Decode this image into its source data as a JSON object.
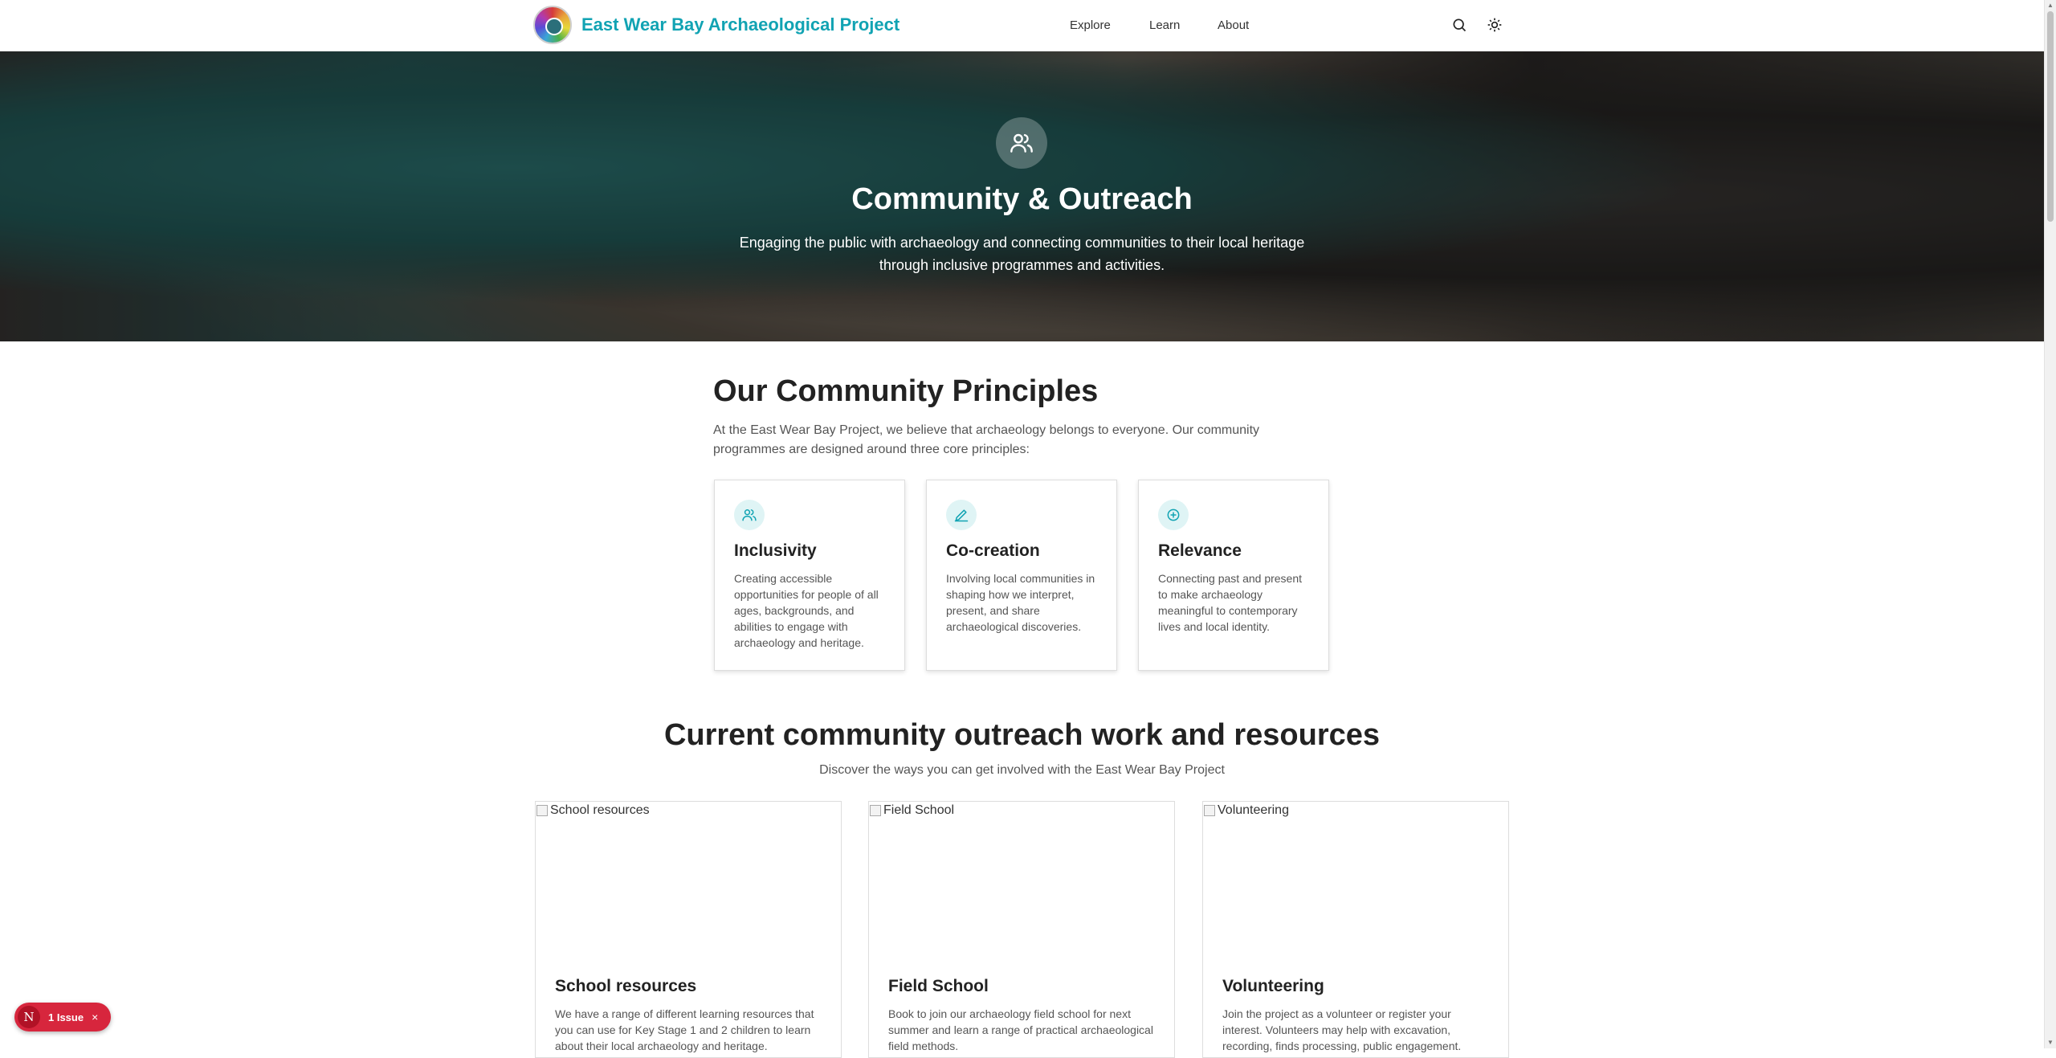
{
  "header": {
    "site_name": "East Wear Bay Archaeological Project",
    "nav": [
      "Explore",
      "Learn",
      "About"
    ],
    "search_icon": "search-icon",
    "theme_icon": "sun-icon"
  },
  "hero": {
    "icon": "users-icon",
    "title": "Community & Outreach",
    "subtitle": "Engaging the public with archaeology and connecting communities to their local heritage through inclusive programmes and activities."
  },
  "principles": {
    "title": "Our Community Principles",
    "intro": "At the East Wear Bay Project, we believe that archaeology belongs to everyone. Our community programmes are designed around three core principles:",
    "cards": [
      {
        "icon": "users-icon",
        "title": "Inclusivity",
        "text": "Creating accessible opportunities for people of all ages, backgrounds, and abilities to engage with archaeology and heritage."
      },
      {
        "icon": "pencil-icon",
        "title": "Co-creation",
        "text": "Involving local communities in shaping how we interpret, present, and share archaeological discoveries."
      },
      {
        "icon": "plus-circle-icon",
        "title": "Relevance",
        "text": "Connecting past and present to make archaeology meaningful to contemporary lives and local identity."
      }
    ]
  },
  "outreach": {
    "title": "Current community outreach work and resources",
    "subtitle": "Discover the ways you can get involved with the East Wear Bay Project",
    "cards": [
      {
        "image_alt": "School resources",
        "title": "School resources",
        "text": "We have a range of different learning resources that you can use for Key Stage 1 and 2 children to learn about their local archaeology and heritage."
      },
      {
        "image_alt": "Field School",
        "title": "Field School",
        "text": "Book to join our archaeology field school for next summer and learn a range of practical archaeological field methods."
      },
      {
        "image_alt": "Volunteering",
        "title": "Volunteering",
        "text": "Join the project as a volunteer or register your interest. Volunteers may help with excavation, recording, finds processing, public engagement."
      }
    ]
  },
  "issue_badge": {
    "logo_letter": "N",
    "label": "1 Issue",
    "close": "×",
    "color": "#d7263d"
  },
  "colors": {
    "brand": "#11a3b3",
    "icon_bg": "#dff4f5"
  }
}
